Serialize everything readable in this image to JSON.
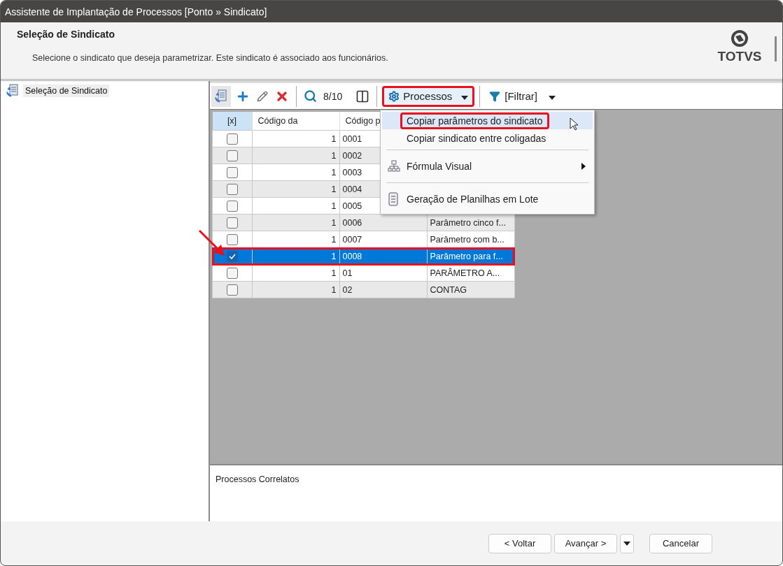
{
  "window": {
    "title": "Assistente de Implantação de Processos [Ponto » Sindicato]"
  },
  "header": {
    "title": "Seleção de Sindicato",
    "description": "Selecione o sindicato que deseja parametrizar. Este sindicato é associado aos funcionários.",
    "logo": "TOTVS"
  },
  "tree": {
    "items": [
      {
        "label": "Seleção de Sindicato",
        "selected": true
      }
    ]
  },
  "toolbar": {
    "counter": "8/10",
    "process_button": {
      "label": "Processos",
      "highlighted": true
    },
    "filter": {
      "label": "[Filtrar]"
    }
  },
  "process_menu": {
    "items": [
      {
        "kind": "plain",
        "label": "Copiar parâmetros do sindicato",
        "hovered": true,
        "highlighted": true
      },
      {
        "kind": "plain",
        "label": "Copiar sindicato entre coligadas",
        "hovered": false,
        "highlighted": false
      },
      {
        "kind": "separator"
      },
      {
        "kind": "submenu",
        "label": "Fórmula Visual",
        "hovered": false,
        "highlighted": false
      },
      {
        "kind": "separator"
      },
      {
        "kind": "sheet",
        "label": "Geração de Planilhas em Lote",
        "hovered": false,
        "highlighted": false
      }
    ]
  },
  "grid": {
    "columns": [
      "[x]",
      "Código da",
      "Código p"
    ],
    "rows": [
      {
        "checked": false,
        "selected": false,
        "highlighted": false,
        "arrow": false,
        "coligada": "1",
        "code": "0001"
      },
      {
        "checked": false,
        "selected": false,
        "highlighted": false,
        "arrow": false,
        "coligada": "1",
        "code": "0002"
      },
      {
        "checked": false,
        "selected": false,
        "highlighted": false,
        "arrow": false,
        "coligada": "1",
        "code": "0003"
      },
      {
        "checked": false,
        "selected": false,
        "highlighted": false,
        "arrow": false,
        "coligada": "1",
        "code": "0004"
      },
      {
        "checked": false,
        "selected": false,
        "highlighted": false,
        "arrow": false,
        "coligada": "1",
        "code": "0005"
      },
      {
        "checked": false,
        "selected": false,
        "highlighted": false,
        "arrow": false,
        "coligada": "1",
        "code": "0006",
        "description": "Parâmetro cinco f..."
      },
      {
        "checked": false,
        "selected": false,
        "highlighted": false,
        "arrow": false,
        "coligada": "1",
        "code": "0007",
        "description": "Parâmetro com b..."
      },
      {
        "checked": true,
        "selected": true,
        "highlighted": true,
        "arrow": true,
        "coligada": "1",
        "code": "0008",
        "description": "Parâmetro para f..."
      },
      {
        "checked": false,
        "selected": false,
        "highlighted": false,
        "arrow": false,
        "coligada": "1",
        "code": "01",
        "description": "PARÂMETRO A..."
      },
      {
        "checked": false,
        "selected": false,
        "highlighted": false,
        "arrow": false,
        "coligada": "1",
        "code": "02",
        "description": "CONTAG"
      }
    ]
  },
  "related": {
    "title": "Processos Correlatos"
  },
  "buttons": [
    {
      "kind": "button",
      "label": "< Voltar"
    },
    {
      "kind": "button",
      "label": "Avançar >"
    },
    {
      "kind": "caret"
    },
    {
      "kind": "spaced",
      "label": "Cancelar"
    }
  ]
}
